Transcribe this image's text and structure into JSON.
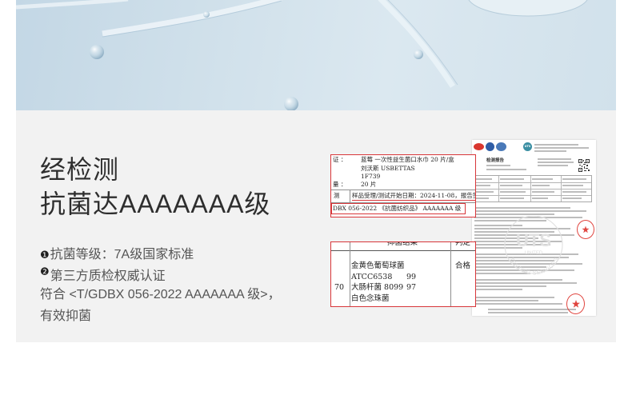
{
  "heading": {
    "line1": "经检测",
    "line2": "抗菌达AAAAAAA级"
  },
  "points": [
    {
      "bullet": "❶",
      "text": "抗菌等级：7A级国家标准"
    },
    {
      "bullet": "❷",
      "text": "第三方质检权威认证"
    }
  ],
  "description": {
    "line1": "符合 <T/GDBX 056-2022 AAAAAAA 级>，",
    "line2": "有效抑菌"
  },
  "report": {
    "info_crop": {
      "row1": {
        "label": "证 ：",
        "value": "蓝莓  一次性益生菌口水巾 20 片/盒"
      },
      "row2": {
        "value": "刘沃斯  USBETTAS"
      },
      "row3": {
        "value": "1F739"
      },
      "row4": {
        "label": "量 ：",
        "value": "20 片"
      },
      "row5": {
        "label": "测",
        "value": "样品受理/测试开始日期：2024-11-08，报告签发日"
      },
      "row6": {
        "value": "DBX 056-2022 《抗菌纺织品》 AAAAAAA 级"
      }
    },
    "result_crop": {
      "header_result": "抑菌结果",
      "header_judgement": "判定",
      "rows": [
        {
          "strain": "金黄色葡萄球菌",
          "judgement": "合格"
        },
        {
          "strain": "ATCC6538",
          "rate": "99"
        },
        {
          "left": "70",
          "strain": "大肠杆菌 8099",
          "rate": "97"
        },
        {
          "strain": "白色念珠菌"
        }
      ]
    },
    "document": {
      "title": "检测报告",
      "logo": "UTS",
      "watermark": {
        "logo": "UTS",
        "line": "UNITED",
        "arc": "TESTING SERVICES"
      },
      "stamp_icon": "star-icon",
      "logo_icons": [
        "certification-logo",
        "certification-logo",
        "certification-logo"
      ]
    }
  },
  "colors": {
    "accent_red": "#d8363a",
    "section_background": "#f2f2f2",
    "banner_blue": "#cfe0ea",
    "text_dark": "#2e2e2e",
    "text_gray": "#555555",
    "watermark_gray": "#dedede"
  }
}
